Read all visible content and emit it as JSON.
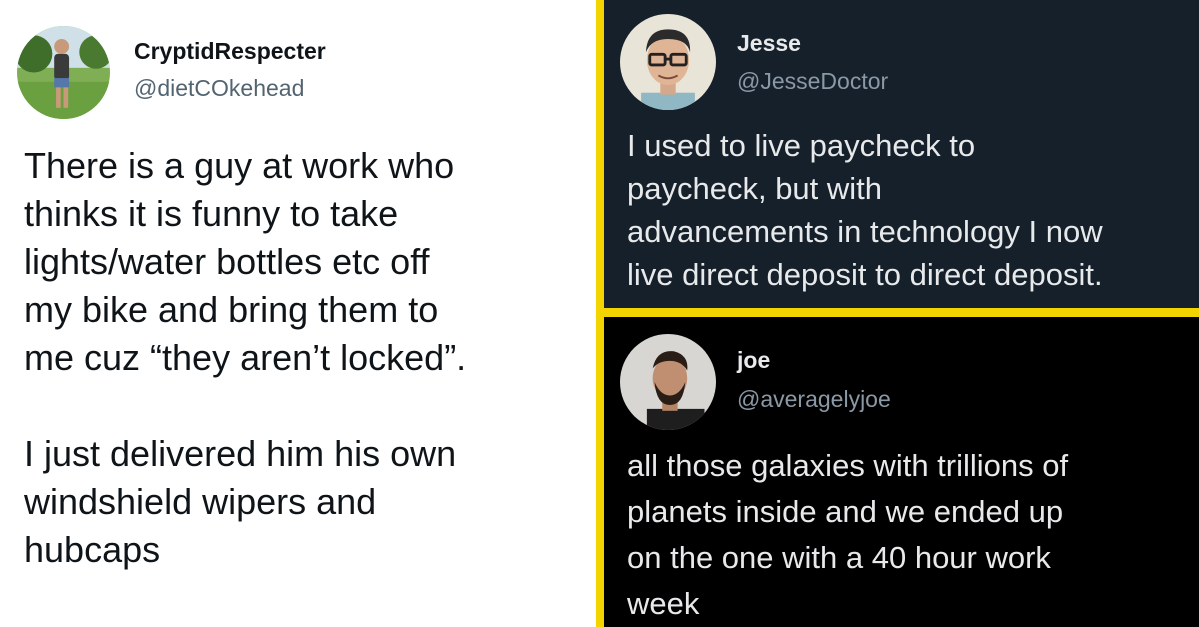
{
  "colors": {
    "divider": "#f4d400",
    "left_bg": "#ffffff",
    "top_right_bg": "#15202b",
    "bottom_right_bg": "#000000"
  },
  "tweets": [
    {
      "display_name": "CryptidRespecter",
      "handle": "@dietCOkehead",
      "avatar_icon": "person-outdoors-avatar",
      "text": "There is a guy at work who\nthinks it is funny to take\nlights/water bottles etc off\nmy bike and bring them to\nme cuz “they aren’t locked”.\n\nI just delivered him his own\nwindshield wipers and\nhubcaps"
    },
    {
      "display_name": "Jesse",
      "handle": "@JesseDoctor",
      "avatar_icon": "cartoon-man-glasses-avatar",
      "text": "I used to live paycheck to\npaycheck, but with\nadvancements in technology I now\nlive direct deposit to direct deposit."
    },
    {
      "display_name": "joe",
      "handle": "@averagelyjoe",
      "avatar_icon": "bearded-man-avatar",
      "text": "all those galaxies with trillions of\nplanets inside and we ended up\non the one with a 40 hour work\nweek"
    }
  ]
}
